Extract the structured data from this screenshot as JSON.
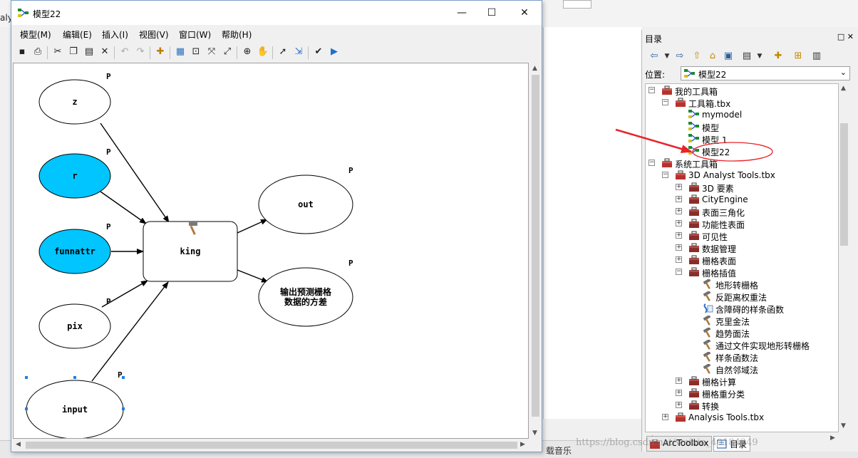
{
  "background": {
    "left_text": "aly",
    "bottom_text": "载音乐"
  },
  "model_window": {
    "title": "模型22",
    "controls": {
      "minimize": "—",
      "maximize": "☐",
      "close": "✕"
    },
    "menu": [
      "模型(M)",
      "编辑(E)",
      "插入(I)",
      "视图(V)",
      "窗口(W)",
      "帮助(H)"
    ],
    "toolbar_icons": [
      "save-icon",
      "print-icon",
      "cut-icon",
      "copy-icon",
      "paste-icon",
      "delete-icon",
      "undo-icon",
      "redo-icon",
      "add-data-icon",
      "auto-layout-icon",
      "full-extent-icon",
      "zoom-in-fixed-icon",
      "zoom-out-fixed-icon",
      "zoom-icon",
      "pan-icon",
      "select-icon",
      "connect-icon",
      "validate-icon",
      "run-icon"
    ],
    "diagram": {
      "param_marker": "P",
      "nodes": [
        {
          "id": "z",
          "label": "z",
          "kind": "variable",
          "fill": "#ffffff"
        },
        {
          "id": "r",
          "label": "r",
          "kind": "variable",
          "fill": "#00c5ff"
        },
        {
          "id": "funnattr",
          "label": "funnattr",
          "kind": "variable",
          "fill": "#00c5ff"
        },
        {
          "id": "pix",
          "label": "pix",
          "kind": "variable",
          "fill": "#ffffff"
        },
        {
          "id": "input",
          "label": "input",
          "kind": "variable",
          "fill": "#ffffff"
        },
        {
          "id": "king",
          "label": "king",
          "kind": "tool",
          "fill": "#ffffff"
        },
        {
          "id": "out",
          "label": "out",
          "kind": "output",
          "fill": "#ffffff"
        },
        {
          "id": "variance",
          "label_lines": [
            "输出预测栅格",
            "数据的方差"
          ],
          "kind": "output",
          "fill": "#ffffff"
        }
      ],
      "edges": [
        {
          "from": "z",
          "to": "king"
        },
        {
          "from": "r",
          "to": "king"
        },
        {
          "from": "funnattr",
          "to": "king"
        },
        {
          "from": "pix",
          "to": "king"
        },
        {
          "from": "input",
          "to": "king"
        },
        {
          "from": "king",
          "to": "out"
        },
        {
          "from": "king",
          "to": "variance"
        }
      ]
    }
  },
  "catalog": {
    "title": "目录",
    "title_buttons": "□ ✕",
    "location_label": "位置:",
    "location_value": "模型22",
    "tree": [
      {
        "label": "我的工具箱",
        "level": 0,
        "toggle": "-",
        "icon": "toolbox-icon"
      },
      {
        "label": "工具箱.tbx",
        "level": 1,
        "toggle": "-",
        "icon": "toolbox-icon"
      },
      {
        "label": "mymodel",
        "level": 2,
        "toggle": "",
        "icon": "model-icon"
      },
      {
        "label": "模型",
        "level": 2,
        "toggle": "",
        "icon": "model-icon"
      },
      {
        "label": "模型 1",
        "level": 2,
        "toggle": "",
        "icon": "model-icon"
      },
      {
        "label": "模型22",
        "level": 2,
        "toggle": "",
        "icon": "model-icon",
        "highlighted": true
      },
      {
        "label": "系统工具箱",
        "level": 0,
        "toggle": "-",
        "icon": "toolbox-icon"
      },
      {
        "label": "3D Analyst Tools.tbx",
        "level": 1,
        "toggle": "-",
        "icon": "toolbox-icon"
      },
      {
        "label": "3D 要素",
        "level": 2,
        "toggle": "+",
        "icon": "toolset-icon"
      },
      {
        "label": "CityEngine",
        "level": 2,
        "toggle": "+",
        "icon": "toolset-icon"
      },
      {
        "label": "表面三角化",
        "level": 2,
        "toggle": "+",
        "icon": "toolset-icon"
      },
      {
        "label": "功能性表面",
        "level": 2,
        "toggle": "+",
        "icon": "toolset-icon"
      },
      {
        "label": "可见性",
        "level": 2,
        "toggle": "+",
        "icon": "toolset-icon"
      },
      {
        "label": "数据管理",
        "level": 2,
        "toggle": "+",
        "icon": "toolset-icon"
      },
      {
        "label": "栅格表面",
        "level": 2,
        "toggle": "+",
        "icon": "toolset-icon"
      },
      {
        "label": "栅格插值",
        "level": 2,
        "toggle": "-",
        "icon": "toolset-icon"
      },
      {
        "label": "地形转栅格",
        "level": 3,
        "toggle": "",
        "icon": "hammer-icon"
      },
      {
        "label": "反距离权重法",
        "level": 3,
        "toggle": "",
        "icon": "hammer-icon"
      },
      {
        "label": "含障碍的样条函数",
        "level": 3,
        "toggle": "",
        "icon": "script-icon"
      },
      {
        "label": "克里金法",
        "level": 3,
        "toggle": "",
        "icon": "hammer-icon"
      },
      {
        "label": "趋势面法",
        "level": 3,
        "toggle": "",
        "icon": "hammer-icon"
      },
      {
        "label": "通过文件实现地形转栅格",
        "level": 3,
        "toggle": "",
        "icon": "hammer-icon"
      },
      {
        "label": "样条函数法",
        "level": 3,
        "toggle": "",
        "icon": "hammer-icon"
      },
      {
        "label": "自然邻域法",
        "level": 3,
        "toggle": "",
        "icon": "hammer-icon"
      },
      {
        "label": "栅格计算",
        "level": 2,
        "toggle": "+",
        "icon": "toolset-icon"
      },
      {
        "label": "栅格重分类",
        "level": 2,
        "toggle": "+",
        "icon": "toolset-icon"
      },
      {
        "label": "转换",
        "level": 2,
        "toggle": "+",
        "icon": "toolset-icon"
      },
      {
        "label": "Analysis Tools.tbx",
        "level": 1,
        "toggle": "+",
        "icon": "toolbox-icon"
      }
    ],
    "tabs": [
      {
        "label": "ArcToolbox",
        "active": false
      },
      {
        "label": "目录",
        "active": true
      }
    ]
  },
  "watermark": "https://blog.csdn.net/weixin_40184249",
  "colors": {
    "accent_blue": "#00c5ff",
    "annotation_red": "#e8242a"
  }
}
